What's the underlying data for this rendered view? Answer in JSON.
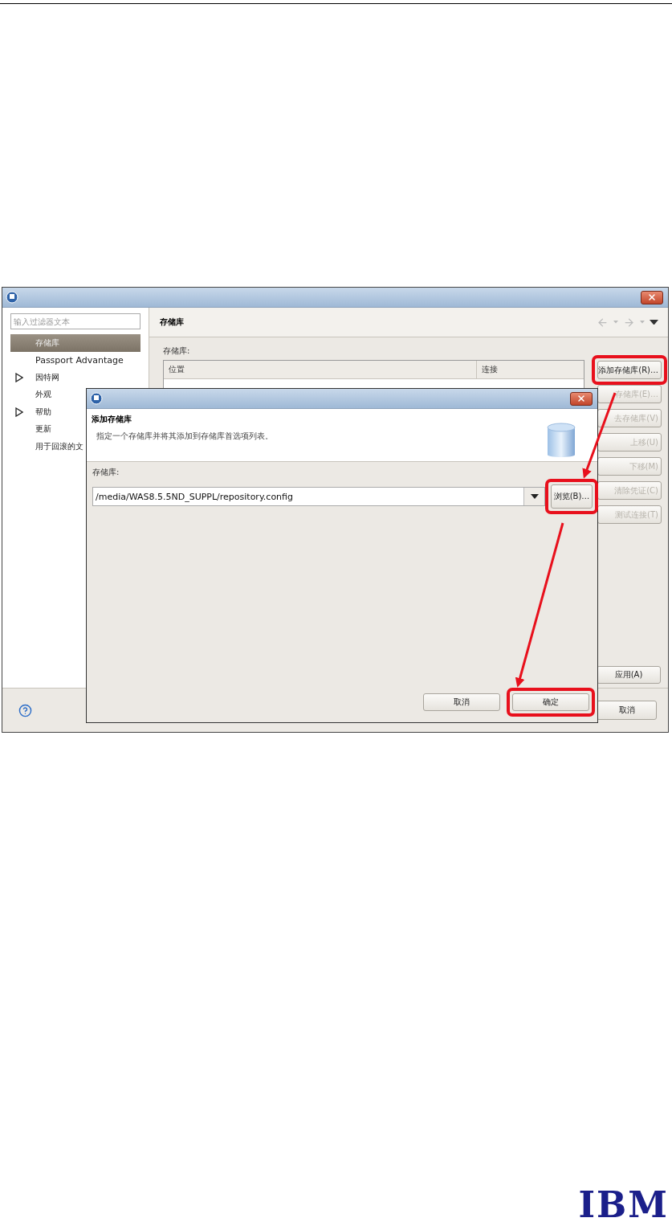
{
  "main_window": {
    "filter_placeholder": "输入过滤器文本",
    "nav_items": [
      {
        "label": "存储库",
        "selected": true,
        "expandable": false
      },
      {
        "label": "Passport Advantage",
        "selected": false,
        "expandable": false
      },
      {
        "label": "因特网",
        "selected": false,
        "expandable": true
      },
      {
        "label": "外观",
        "selected": false,
        "expandable": false
      },
      {
        "label": "帮助",
        "selected": false,
        "expandable": true
      },
      {
        "label": "更新",
        "selected": false,
        "expandable": false
      },
      {
        "label": "用于回滚的文",
        "selected": false,
        "expandable": false
      }
    ],
    "panel_title": "存储库",
    "section_label": "存储库:",
    "table": {
      "columns": [
        "位置",
        "连接"
      ]
    },
    "side_buttons": [
      {
        "label": "添加存储库(R)…",
        "disabled": false,
        "highlighted": true
      },
      {
        "label": "存储库(E)…",
        "disabled": true,
        "highlighted": false
      },
      {
        "label": "去存储库(V)",
        "disabled": true,
        "highlighted": false
      },
      {
        "label": "上移(U)",
        "disabled": true,
        "highlighted": false
      },
      {
        "label": "下移(M)",
        "disabled": true,
        "highlighted": false
      },
      {
        "label": "清除凭证(C)",
        "disabled": true,
        "highlighted": false
      },
      {
        "label": "测试连接(T)",
        "disabled": true,
        "highlighted": false
      }
    ],
    "apply_button": "应用(A)",
    "cancel_button": "取消"
  },
  "dialog": {
    "heading": "添加存储库",
    "description": "指定一个存储库并将其添加到存储库首选项列表。",
    "field_label": "存储库:",
    "repository_value": "/media/WAS8.5.5ND_SUPPL/repository.config",
    "browse_button": {
      "label": "浏览(B)…",
      "highlighted": true
    },
    "buttons": [
      {
        "label": "取消",
        "highlighted": false
      },
      {
        "label": "确定",
        "highlighted": true
      }
    ]
  },
  "page": {
    "logo": "IBM"
  }
}
